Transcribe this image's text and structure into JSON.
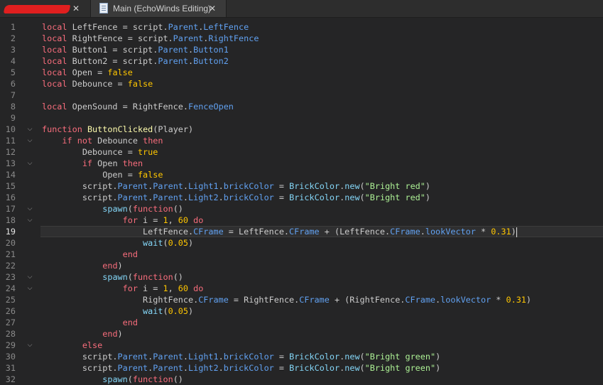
{
  "tabs": [
    {
      "label": "",
      "redacted": true,
      "close": "✕"
    },
    {
      "label": "Main (EchoWinds Editing)",
      "icon": "script-document-icon",
      "close": "✕",
      "active": true
    }
  ],
  "editor": {
    "current_line": 19,
    "fold_lines": [
      10,
      11,
      13,
      17,
      18,
      23,
      24,
      29
    ],
    "lines": [
      {
        "n": "1",
        "html": "<span class='kw'>local</span> LeftFence = script.<span class='pr'>Parent</span>.<span class='pr'>LeftFence</span>"
      },
      {
        "n": "2",
        "html": "<span class='kw'>local</span> RightFence = script.<span class='pr'>Parent</span>.<span class='pr'>RightFence</span>"
      },
      {
        "n": "3",
        "html": "<span class='kw'>local</span> Button1 = script.<span class='pr'>Parent</span>.<span class='pr'>Button1</span>"
      },
      {
        "n": "4",
        "html": "<span class='kw'>local</span> Button2 = script.<span class='pr'>Parent</span>.<span class='pr'>Button2</span>"
      },
      {
        "n": "5",
        "html": "<span class='kw'>local</span> Open = <span class='bo'>false</span>"
      },
      {
        "n": "6",
        "html": "<span class='kw'>local</span> Debounce = <span class='bo'>false</span>"
      },
      {
        "n": "7",
        "html": ""
      },
      {
        "n": "8",
        "html": "<span class='kw'>local</span> OpenSound = RightFence.<span class='pr'>FenceOpen</span>"
      },
      {
        "n": "9",
        "html": ""
      },
      {
        "n": "10",
        "html": "<span class='kw'>function</span> <span class='fn'>ButtonClicked</span>(Player)"
      },
      {
        "n": "11",
        "html": "    <span class='kw'>if</span> <span class='kw'>not</span> Debounce <span class='kw'>then</span>"
      },
      {
        "n": "12",
        "html": "        Debounce = <span class='bo'>true</span>"
      },
      {
        "n": "13",
        "html": "        <span class='kw'>if</span> Open <span class='kw'>then</span>"
      },
      {
        "n": "14",
        "html": "            Open = <span class='bo'>false</span>"
      },
      {
        "n": "15",
        "html": "        script.<span class='pr'>Parent</span>.<span class='pr'>Parent</span>.<span class='pr'>Light1</span>.<span class='pr'>brickColor</span> = <span class='bi'>BrickColor</span>.<span class='bi'>new</span>(<span class='st'>\"Bright red\"</span>)"
      },
      {
        "n": "16",
        "html": "        script.<span class='pr'>Parent</span>.<span class='pr'>Parent</span>.<span class='pr'>Light2</span>.<span class='pr'>brickColor</span> = <span class='bi'>BrickColor</span>.<span class='bi'>new</span>(<span class='st'>\"Bright red\"</span>)"
      },
      {
        "n": "17",
        "html": "            <span class='bi'>spawn</span>(<span class='kw'>function</span>()"
      },
      {
        "n": "18",
        "html": "                <span class='kw'>for</span> i = <span class='nu'>1</span>, <span class='nu'>60</span> <span class='kw'>do</span>"
      },
      {
        "n": "19",
        "html": "                    LeftFence.<span class='pr'>CFrame</span> = LeftFence.<span class='pr'>CFrame</span> + (LeftFence.<span class='pr'>CFrame</span>.<span class='pr'>lookVector</span> * <span class='nu'>0.31</span>)<span class='caret'></span>"
      },
      {
        "n": "20",
        "html": "                    <span class='bi'>wait</span>(<span class='nu'>0.05</span>)"
      },
      {
        "n": "21",
        "html": "                <span class='kw'>end</span>"
      },
      {
        "n": "22",
        "html": "            <span class='kw'>end</span>)"
      },
      {
        "n": "23",
        "html": "            <span class='bi'>spawn</span>(<span class='kw'>function</span>()"
      },
      {
        "n": "24",
        "html": "                <span class='kw'>for</span> i = <span class='nu'>1</span>, <span class='nu'>60</span> <span class='kw'>do</span>"
      },
      {
        "n": "25",
        "html": "                    RightFence.<span class='pr'>CFrame</span> = RightFence.<span class='pr'>CFrame</span> + (RightFence.<span class='pr'>CFrame</span>.<span class='pr'>lookVector</span> * <span class='nu'>0.31</span>)"
      },
      {
        "n": "26",
        "html": "                    <span class='bi'>wait</span>(<span class='nu'>0.05</span>)"
      },
      {
        "n": "27",
        "html": "                <span class='kw'>end</span>"
      },
      {
        "n": "28",
        "html": "            <span class='kw'>end</span>)"
      },
      {
        "n": "29",
        "html": "        <span class='kw'>else</span>"
      },
      {
        "n": "30",
        "html": "        script.<span class='pr'>Parent</span>.<span class='pr'>Parent</span>.<span class='pr'>Light1</span>.<span class='pr'>brickColor</span> = <span class='bi'>BrickColor</span>.<span class='bi'>new</span>(<span class='st'>\"Bright green\"</span>)"
      },
      {
        "n": "31",
        "html": "        script.<span class='pr'>Parent</span>.<span class='pr'>Parent</span>.<span class='pr'>Light2</span>.<span class='pr'>brickColor</span> = <span class='bi'>BrickColor</span>.<span class='bi'>new</span>(<span class='st'>\"Bright green\"</span>)"
      },
      {
        "n": "32",
        "html": "            <span class='bi'>spawn</span>(<span class='kw'>function</span>()"
      }
    ]
  }
}
